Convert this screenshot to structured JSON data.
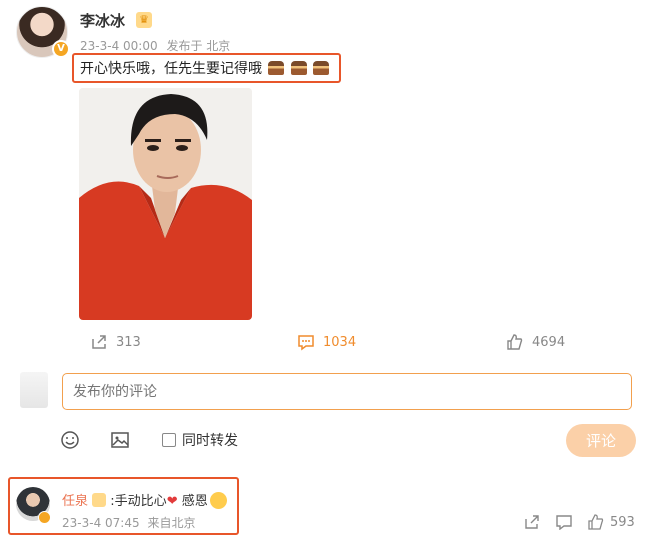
{
  "post": {
    "author": "李冰冰",
    "date": "23-3-4 00:00",
    "location": "发布于 北京",
    "text": "开心快乐哦，任先生要记得哦",
    "emoji": [
      "cake-icon",
      "cake-icon",
      "cake-icon"
    ],
    "stats": {
      "reposts": "313",
      "comments": "1034",
      "likes": "4694"
    }
  },
  "composer": {
    "placeholder": "发布你的评论",
    "repost_label": "同时转发",
    "submit_label": "评论"
  },
  "reply": {
    "author": "任泉",
    "text": ":手动比心",
    "text2": " 感恩",
    "date": "23-3-4 07:45",
    "source": "来自北京",
    "likes": "593"
  },
  "colors": {
    "accent": "#f08c2d",
    "highlight_box": "#e8562a",
    "name_link": "#eb7350",
    "submit_disabled": "#fbd0a8"
  }
}
